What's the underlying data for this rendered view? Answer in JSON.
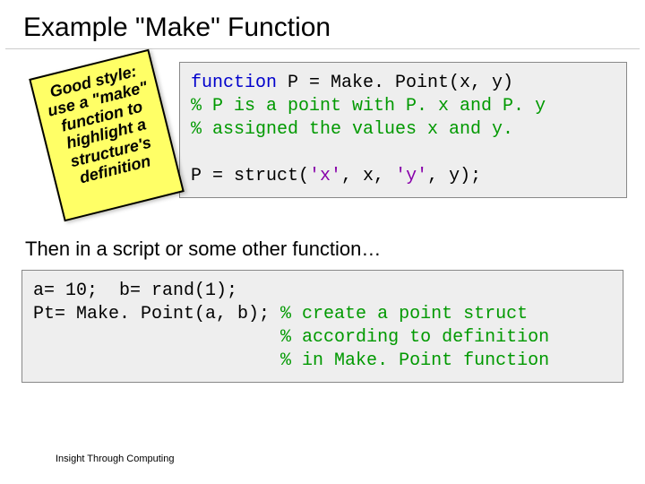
{
  "title": "Example \"Make\" Function",
  "sticky": {
    "line1": "Good style:",
    "line2": "use a \"make\"",
    "line3": "function to",
    "line4": "highlight a",
    "line5": "structure's",
    "line6": "definition"
  },
  "code1": {
    "l1a": "function",
    "l1b": " P = Make. Point(x, y)",
    "l2": "% P is a point with P. x and P. y",
    "l3": "% assigned the values x and y.",
    "l4a": "P = struct(",
    "l4b": "'x'",
    "l4c": ", x, ",
    "l4d": "'y'",
    "l4e": ", y);"
  },
  "mid": "Then in a script or some other function…",
  "code2": {
    "l1": "a= 10;  b= rand(1);",
    "l2a": "Pt= Make. Point(a, b); ",
    "l2b": "% create a point struct",
    "l3": "                       % according to definition",
    "l4": "                       % in Make. Point function"
  },
  "footer": "Insight Through Computing"
}
